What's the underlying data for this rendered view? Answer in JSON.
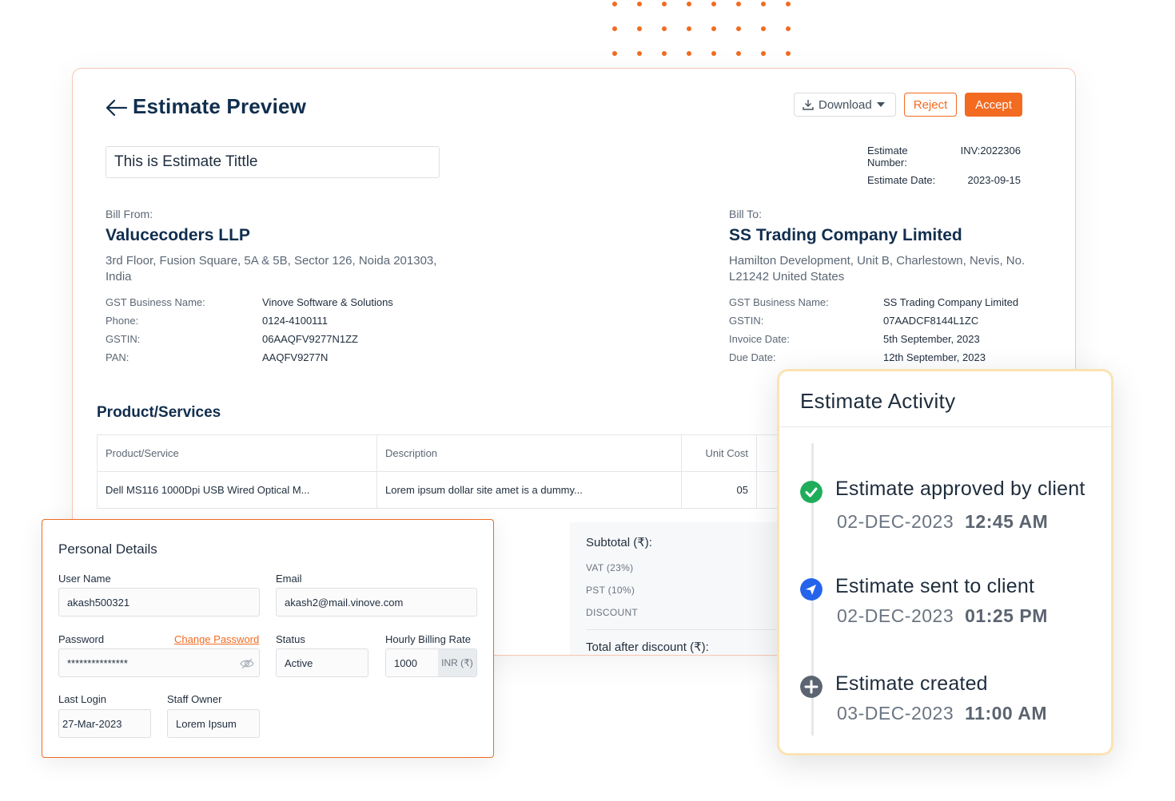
{
  "header": {
    "title": "Estimate Preview",
    "download_label": "Download",
    "reject_label": "Reject",
    "accept_label": "Accept"
  },
  "estimate": {
    "title_value": "This is Estimate Tittle",
    "number_label": "Estimate Number:",
    "number_value": "INV:2022306",
    "date_label": "Estimate Date:",
    "date_value": "2023-09-15"
  },
  "bill_from": {
    "label": "Bill From:",
    "company": "Valucecoders LLP",
    "address": "3rd Floor, Fusion Square, 5A & 5B, Sector 126, Noida 201303, India",
    "fields": [
      {
        "k": "GST Business Name:",
        "v": "Vinove Software & Solutions"
      },
      {
        "k": "Phone:",
        "v": "0124-4100111"
      },
      {
        "k": "GSTIN:",
        "v": "06AAQFV9277N1ZZ"
      },
      {
        "k": "PAN:",
        "v": "AAQFV9277N"
      }
    ]
  },
  "bill_to": {
    "label": "Bill To:",
    "company": "SS Trading Company Limited",
    "address": "Hamilton Development, Unit B, Charlestown, Nevis, No. L21242 United States",
    "fields": [
      {
        "k": "GST Business Name:",
        "v": "SS Trading Company Limited"
      },
      {
        "k": "GSTIN:",
        "v": "07AADCF8144L1ZC"
      },
      {
        "k": "Invoice Date:",
        "v": "5th September, 2023"
      },
      {
        "k": "Due Date:",
        "v": "12th September, 2023"
      }
    ]
  },
  "products": {
    "section_title": "Product/Services",
    "columns": [
      "Product/Service",
      "Description",
      "Unit Cost"
    ],
    "rows": [
      [
        "Dell MS116 1000Dpi USB Wired Optical M...",
        "Lorem ipsum dollar site amet is a dummy...",
        "05"
      ]
    ]
  },
  "totals": {
    "subtotal": "Subtotal (₹):",
    "vat": "VAT (23%)",
    "pst": "PST (10%)",
    "discount": "DISCOUNT",
    "after_discount": "Total after discount (₹):"
  },
  "personal": {
    "title": "Personal Details",
    "username_label": "User Name",
    "username_value": "akash500321",
    "email_label": "Email",
    "email_value": "akash2@mail.vinove.com",
    "password_label": "Password",
    "change_password": "Change Password",
    "password_value": "***************",
    "status_label": "Status",
    "status_value": "Active",
    "rate_label": "Hourly Billing Rate",
    "rate_value": "1000",
    "rate_currency": "INR (₹)",
    "last_login_label": "Last Login",
    "last_login_value": "27-Mar-2023",
    "staff_owner_label": "Staff Owner",
    "staff_owner_value": "Lorem Ipsum"
  },
  "activity": {
    "title": "Estimate Activity",
    "items": [
      {
        "text": "Estimate approved by client",
        "date": "02-DEC-2023",
        "time": "12:45 AM",
        "icon": "check-circle-icon",
        "color": "#1fad5b"
      },
      {
        "text": "Estimate sent to client",
        "date": "02-DEC-2023",
        "time": "01:25 PM",
        "icon": "send-icon",
        "color": "#2563eb"
      },
      {
        "text": "Estimate created",
        "date": "03-DEC-2023",
        "time": "11:00 AM",
        "icon": "plus-circle-icon",
        "color": "#5b6470"
      }
    ]
  },
  "colors": {
    "accent": "#f26b21",
    "heading": "#112e4e",
    "activity_border": "#fbe3b4"
  }
}
